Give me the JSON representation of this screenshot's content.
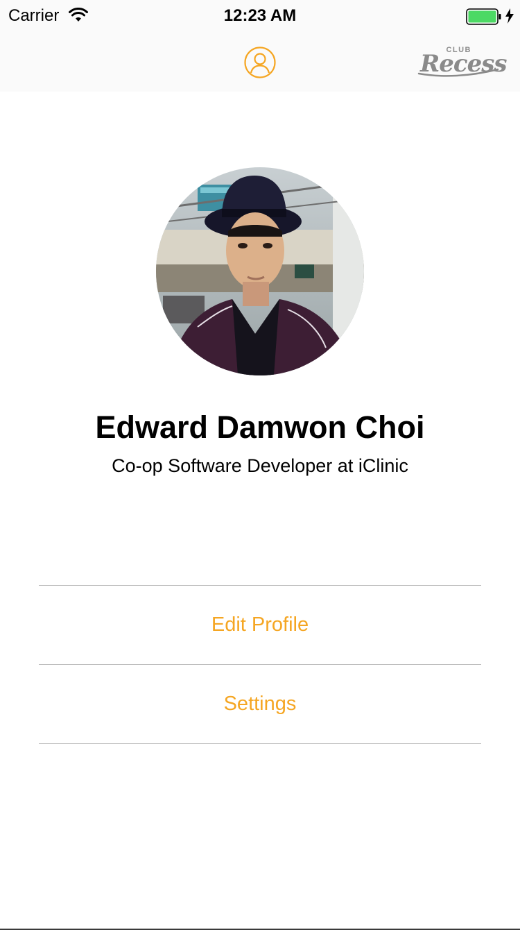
{
  "status_bar": {
    "carrier": "Carrier",
    "time": "12:23 AM",
    "wifi_icon": "wifi-icon",
    "battery_icon": "battery-charging-icon",
    "battery_color": "#4cd964"
  },
  "nav_bar": {
    "profile_icon": "user-circle-icon",
    "logo": {
      "club": "CLUB",
      "name": "Recess"
    }
  },
  "profile": {
    "avatar_icon": "user-photo",
    "name": "Edward Damwon Choi",
    "title": "Co-op Software Developer at iClinic"
  },
  "menu": {
    "items": [
      {
        "label": "Edit Profile"
      },
      {
        "label": "Settings"
      }
    ]
  },
  "colors": {
    "accent": "#f5a623",
    "divider": "#bcbcbc",
    "bar_background": "#fafafa"
  }
}
